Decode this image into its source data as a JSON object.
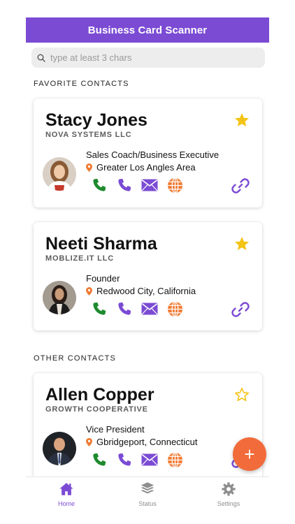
{
  "header": {
    "title": "Business Card Scanner"
  },
  "search": {
    "placeholder": "type at least 3 chars"
  },
  "sections": {
    "favorites": "FAVORITE CONTACTS",
    "others": "OTHER CONTACTS"
  },
  "contacts": [
    {
      "name": "Stacy Jones",
      "company": "NOVA SYSTEMS LLC",
      "title": "Sales Coach/Business Executive",
      "location": "Greater Los Angles Area",
      "favorite": true
    },
    {
      "name": "Neeti Sharma",
      "company": "MOBLIZE.IT LLC",
      "title": "Founder",
      "location": "Redwood City, California",
      "favorite": true
    },
    {
      "name": "Allen Copper",
      "company": "GROWTH COOPERATIVE",
      "title": "Vice President",
      "location": "Gbridgeport, Connecticut",
      "favorite": false
    }
  ],
  "fab": {
    "label": "+"
  },
  "tabs": [
    {
      "label": "Home",
      "icon": "home-icon",
      "active": true
    },
    {
      "label": "Status",
      "icon": "layers-icon",
      "active": false
    },
    {
      "label": "Settings",
      "icon": "gear-icon",
      "active": false
    }
  ],
  "colors": {
    "accent": "#7b4bd4",
    "fab": "#f26b3a",
    "phone": "#1e8a2e",
    "star": "#f3c316",
    "web": "#f07a32"
  }
}
